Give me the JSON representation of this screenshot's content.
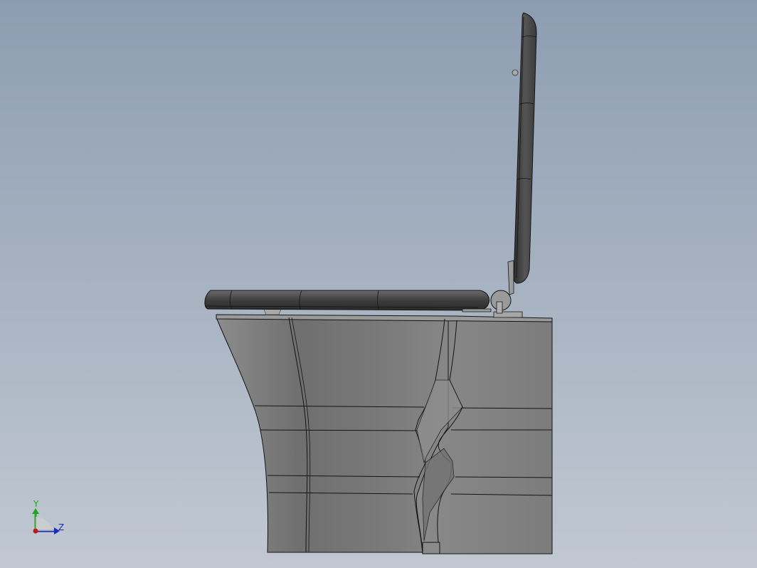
{
  "viewport": {
    "background_top": "#8d9db1",
    "background_bottom": "#c1c8d2"
  },
  "model": {
    "body_color": "#7a7a7a",
    "seat_color": "#4a4a4a",
    "edge_color": "#141414"
  },
  "triad": {
    "y_label": "Y",
    "z_label": "Z",
    "y_color": "#1fa71f",
    "z_color": "#1a2fb0",
    "x_color": "#c21a1a"
  }
}
